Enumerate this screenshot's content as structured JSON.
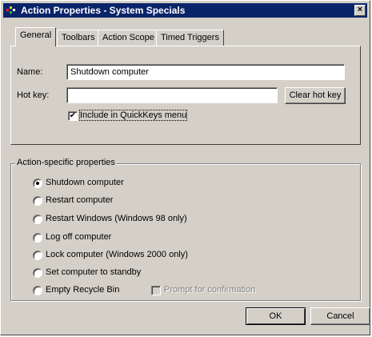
{
  "window": {
    "title": "Action Properties - System Specials",
    "close_glyph": "×"
  },
  "tabs": [
    {
      "label": "General",
      "active": true
    },
    {
      "label": "Toolbars",
      "active": false
    },
    {
      "label": "Action Scope",
      "active": false
    },
    {
      "label": "Timed Triggers",
      "active": false
    }
  ],
  "general": {
    "name_label": "Name:",
    "name_value": "Shutdown computer",
    "hotkey_label": "Hot key:",
    "hotkey_value": "",
    "clear_hotkey_label": "Clear hot key",
    "include_label": "Include in QuickKeys menu",
    "include_checked": true
  },
  "action_props": {
    "legend": "Action-specific properties",
    "options": [
      {
        "label": "Shutdown computer",
        "selected": true
      },
      {
        "label": "Restart computer",
        "selected": false
      },
      {
        "label": "Restart Windows (Windows 98 only)",
        "selected": false
      },
      {
        "label": "Log off computer",
        "selected": false
      },
      {
        "label": "Lock computer (Windows 2000 only)",
        "selected": false
      },
      {
        "label": "Set computer to standby",
        "selected": false
      },
      {
        "label": "Empty Recycle Bin",
        "selected": false
      }
    ],
    "prompt_label": "Prompt for confirmation",
    "prompt_checked": false
  },
  "footer": {
    "ok_label": "OK",
    "cancel_label": "Cancel"
  },
  "colors": {
    "titlebar": "#0a246a",
    "face": "#d4d0c8"
  }
}
